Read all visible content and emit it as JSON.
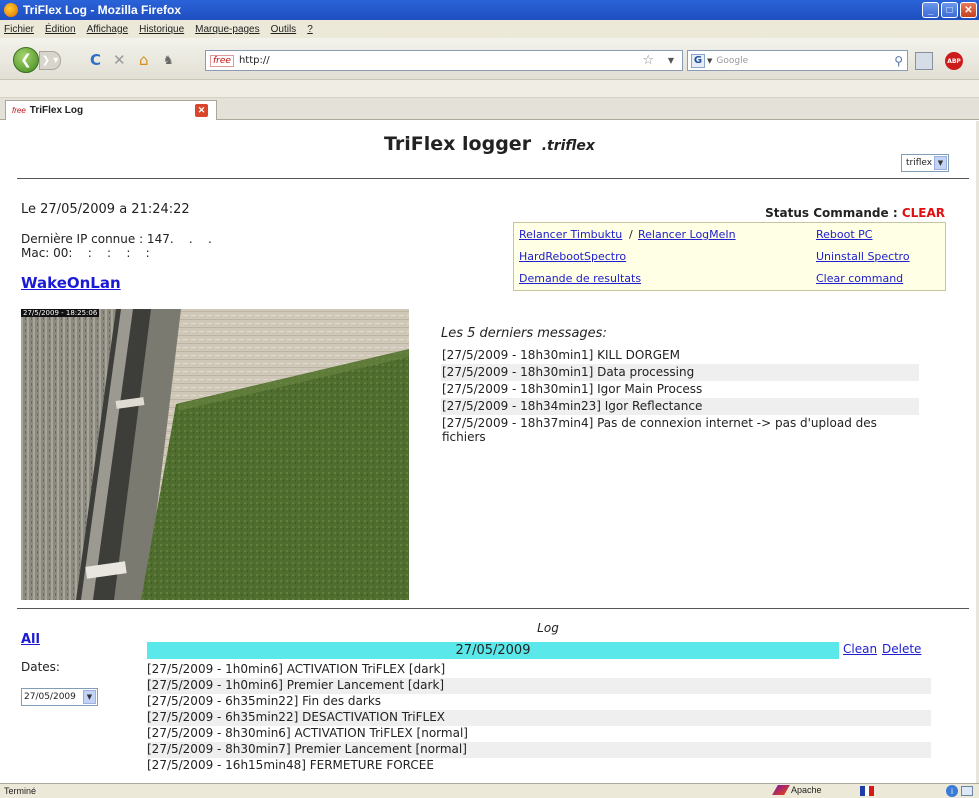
{
  "window": {
    "title": "TriFlex Log - Mozilla Firefox",
    "buttons": [
      "_",
      "□",
      "✕"
    ]
  },
  "menu": [
    "Fichier",
    "Édition",
    "Affichage",
    "Historique",
    "Marque-pages",
    "Outils",
    "?"
  ],
  "nav": {
    "url": "http://",
    "favicon_text": "free",
    "search_placeholder": "Google",
    "search_engine": "G",
    "abp_text": "ABP"
  },
  "tab": {
    "title": "TriFlex Log",
    "favicon_text": "free"
  },
  "page": {
    "title": "TriFlex logger",
    "subtitle": ".triflex",
    "project_select": "triflex",
    "date_time": "Le 27/05/2009 a 21:24:22",
    "ip": "Dernière IP connue : 147.    .    .",
    "mac": "Mac: 00:    :    :    :    :",
    "wol_link": "WakeOnLan",
    "status_label": "Status Commande :",
    "status_value": "CLEAR",
    "commands": {
      "relancer_timbuktu": "Relancer Timbuktu",
      "separator": "/",
      "relancer_logmein": "Relancer LogMeIn",
      "reboot_pc": "Reboot PC",
      "hard_reboot": "HardRebootSpectro",
      "uninstall": "Uninstall Spectro",
      "demande": "Demande de resultats",
      "clear": "Clear command"
    },
    "camera_timestamp": "27/5/2009 - 18:25:06",
    "messages_title": "Les 5 derniers messages:",
    "messages": [
      "[27/5/2009 - 18h30min1] KILL DORGEM",
      "[27/5/2009 - 18h30min1] Data processing",
      "[27/5/2009 - 18h30min1] Igor Main Process",
      "[27/5/2009 - 18h34min23] Igor Reflectance",
      "[27/5/2009 - 18h37min4] Pas de connexion internet -> pas d'upload des fichiers"
    ],
    "log": {
      "title": "Log",
      "all_link": "All",
      "dates_label": "Dates:",
      "date_select": "27/05/2009",
      "day": "27/05/2009",
      "clean": "Clean",
      "delete": "Delete",
      "lines": [
        "[27/5/2009 - 1h0min6] ACTIVATION TriFLEX [dark]",
        "[27/5/2009 - 1h0min6] Premier Lancement [dark]",
        "[27/5/2009 - 6h35min22] Fin des darks",
        "[27/5/2009 - 6h35min22] DESACTIVATION TriFLEX",
        "[27/5/2009 - 8h30min6] ACTIVATION TriFLEX [normal]",
        "[27/5/2009 - 8h30min7] Premier Lancement [normal]",
        "[27/5/2009 - 16h15min48] FERMETURE FORCEE"
      ]
    }
  },
  "statusbar": {
    "left": "Terminé",
    "server": "Apache"
  },
  "colors": {
    "status_clear": "#e01010",
    "day_header_bg": "#5be8ea",
    "command_box_bg": "#ffffe6",
    "link": "#2020cc"
  }
}
